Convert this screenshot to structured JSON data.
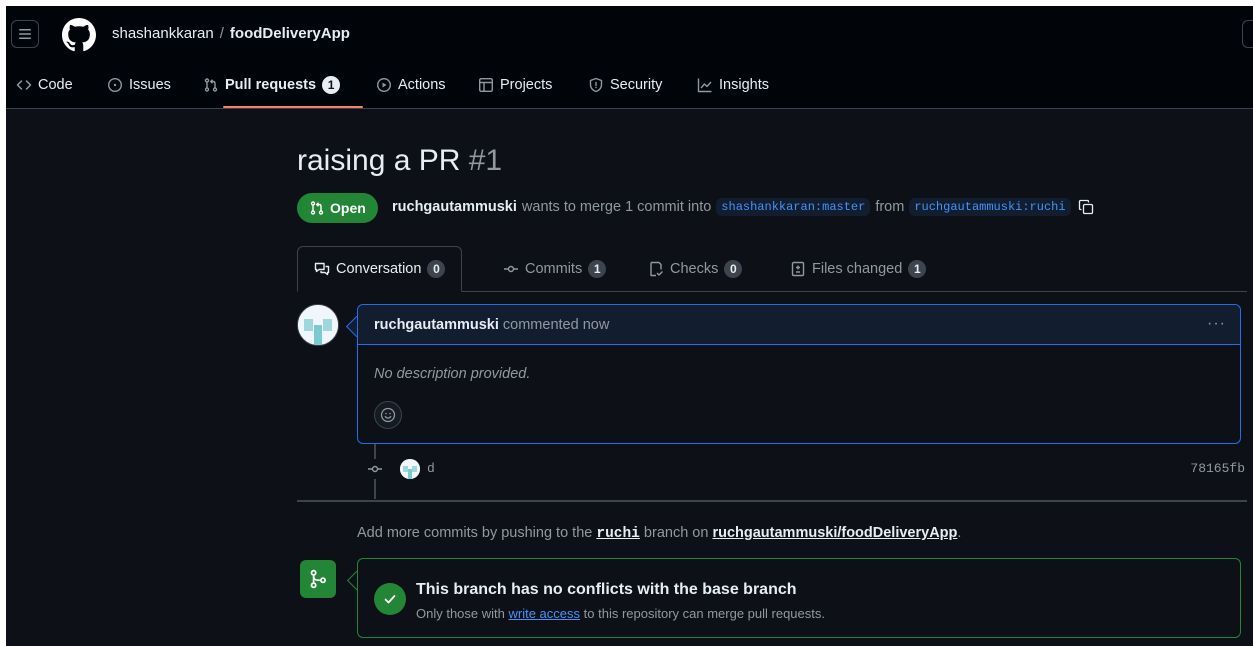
{
  "header": {
    "owner": "shashankkaran",
    "separator": "/",
    "repo": "foodDeliveryApp"
  },
  "nav": {
    "items": [
      {
        "label": "Code",
        "icon": "code-icon"
      },
      {
        "label": "Issues",
        "icon": "issue-opened-icon"
      },
      {
        "label": "Pull requests",
        "icon": "git-pull-request-icon",
        "count": "1",
        "active": true
      },
      {
        "label": "Actions",
        "icon": "play-icon"
      },
      {
        "label": "Projects",
        "icon": "table-icon"
      },
      {
        "label": "Security",
        "icon": "shield-icon"
      },
      {
        "label": "Insights",
        "icon": "graph-icon"
      }
    ]
  },
  "pr": {
    "title": "raising a PR",
    "number": "#1",
    "state": "Open",
    "author": "ruchgautammuski",
    "merge_text": "wants to merge 1 commit into",
    "base_branch": "shashankkaran:master",
    "from_text": "from",
    "head_branch": "ruchgautammuski:ruchi"
  },
  "tabs": [
    {
      "label": "Conversation",
      "count": "0",
      "icon": "comment-discussion-icon"
    },
    {
      "label": "Commits",
      "count": "1",
      "icon": "git-commit-icon"
    },
    {
      "label": "Checks",
      "count": "0",
      "icon": "checklist-icon"
    },
    {
      "label": "Files changed",
      "count": "1",
      "icon": "file-diff-icon"
    }
  ],
  "comment": {
    "author": "ruchgautammuski",
    "action": "commented now",
    "menu": "···",
    "body": "No description provided."
  },
  "commit": {
    "message": "d",
    "sha": "78165fb"
  },
  "push_hint": {
    "prefix": "Add more commits by pushing to the",
    "branch": "ruchi",
    "middle": "branch on",
    "repo": "ruchgautammuski/foodDeliveryApp",
    "suffix": "."
  },
  "merge": {
    "title": "This branch has no conflicts with the base branch",
    "sub_prefix": "Only those with",
    "sub_link": "write access",
    "sub_suffix": "to this repository can merge pull requests."
  },
  "colors": {
    "background": "#0d1117",
    "header": "#010409",
    "accent_green": "#238636",
    "link_blue": "#4493f8",
    "tab_underline": "#f78166"
  }
}
